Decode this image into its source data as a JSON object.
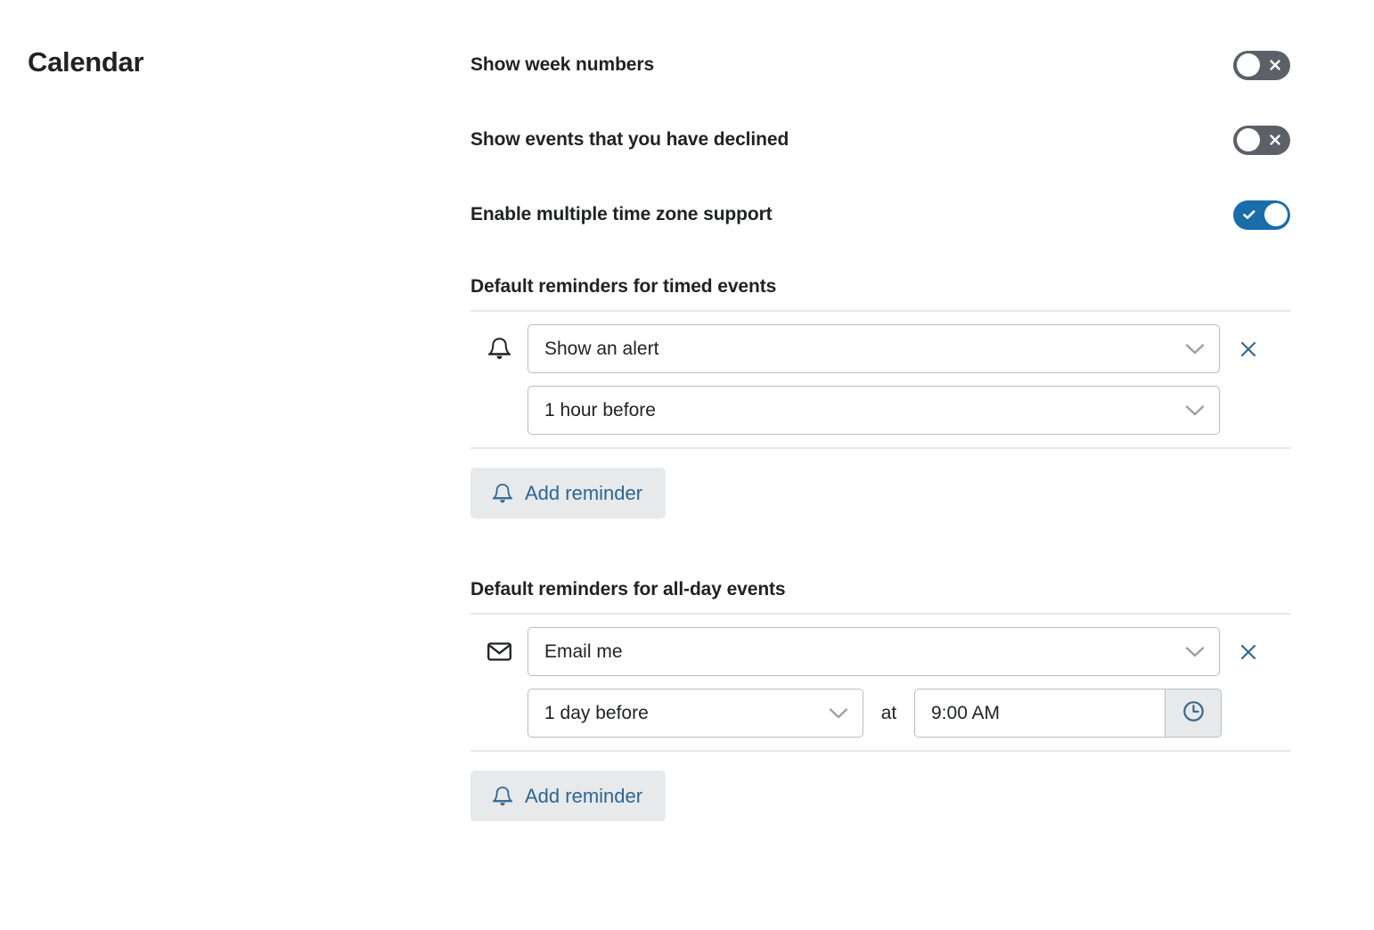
{
  "page": {
    "title": "Calendar"
  },
  "toggles": [
    {
      "label": "Show week numbers",
      "state": "off",
      "icon": "close-icon"
    },
    {
      "label": "Show events that you have declined",
      "state": "off",
      "icon": "close-icon"
    },
    {
      "label": "Enable multiple time zone support",
      "state": "on",
      "icon": "check-icon"
    }
  ],
  "timed_events": {
    "heading": "Default reminders for timed events",
    "reminder": {
      "type_icon": "bell-icon",
      "method": "Show an alert",
      "timing": "1 hour before",
      "remove_label": "✕"
    },
    "add_button": {
      "label": "Add reminder",
      "icon": "bell-icon"
    }
  },
  "all_day_events": {
    "heading": "Default reminders for all-day events",
    "reminder": {
      "type_icon": "envelope-icon",
      "method": "Email me",
      "timing": "1 day before",
      "at_label": "at",
      "time": "9:00 AM",
      "time_icon": "clock-icon",
      "remove_label": "✕"
    },
    "add_button": {
      "label": "Add reminder",
      "icon": "bell-icon"
    }
  },
  "colors": {
    "accent_blue": "#1b6cab",
    "link_blue": "#2d6694",
    "toggle_off_gray": "#5b6166",
    "button_gray": "#e7e9eb",
    "border_gray": "#b9bcc0",
    "divider_gray": "#e7e8ea",
    "text_dark": "#1f2124"
  }
}
